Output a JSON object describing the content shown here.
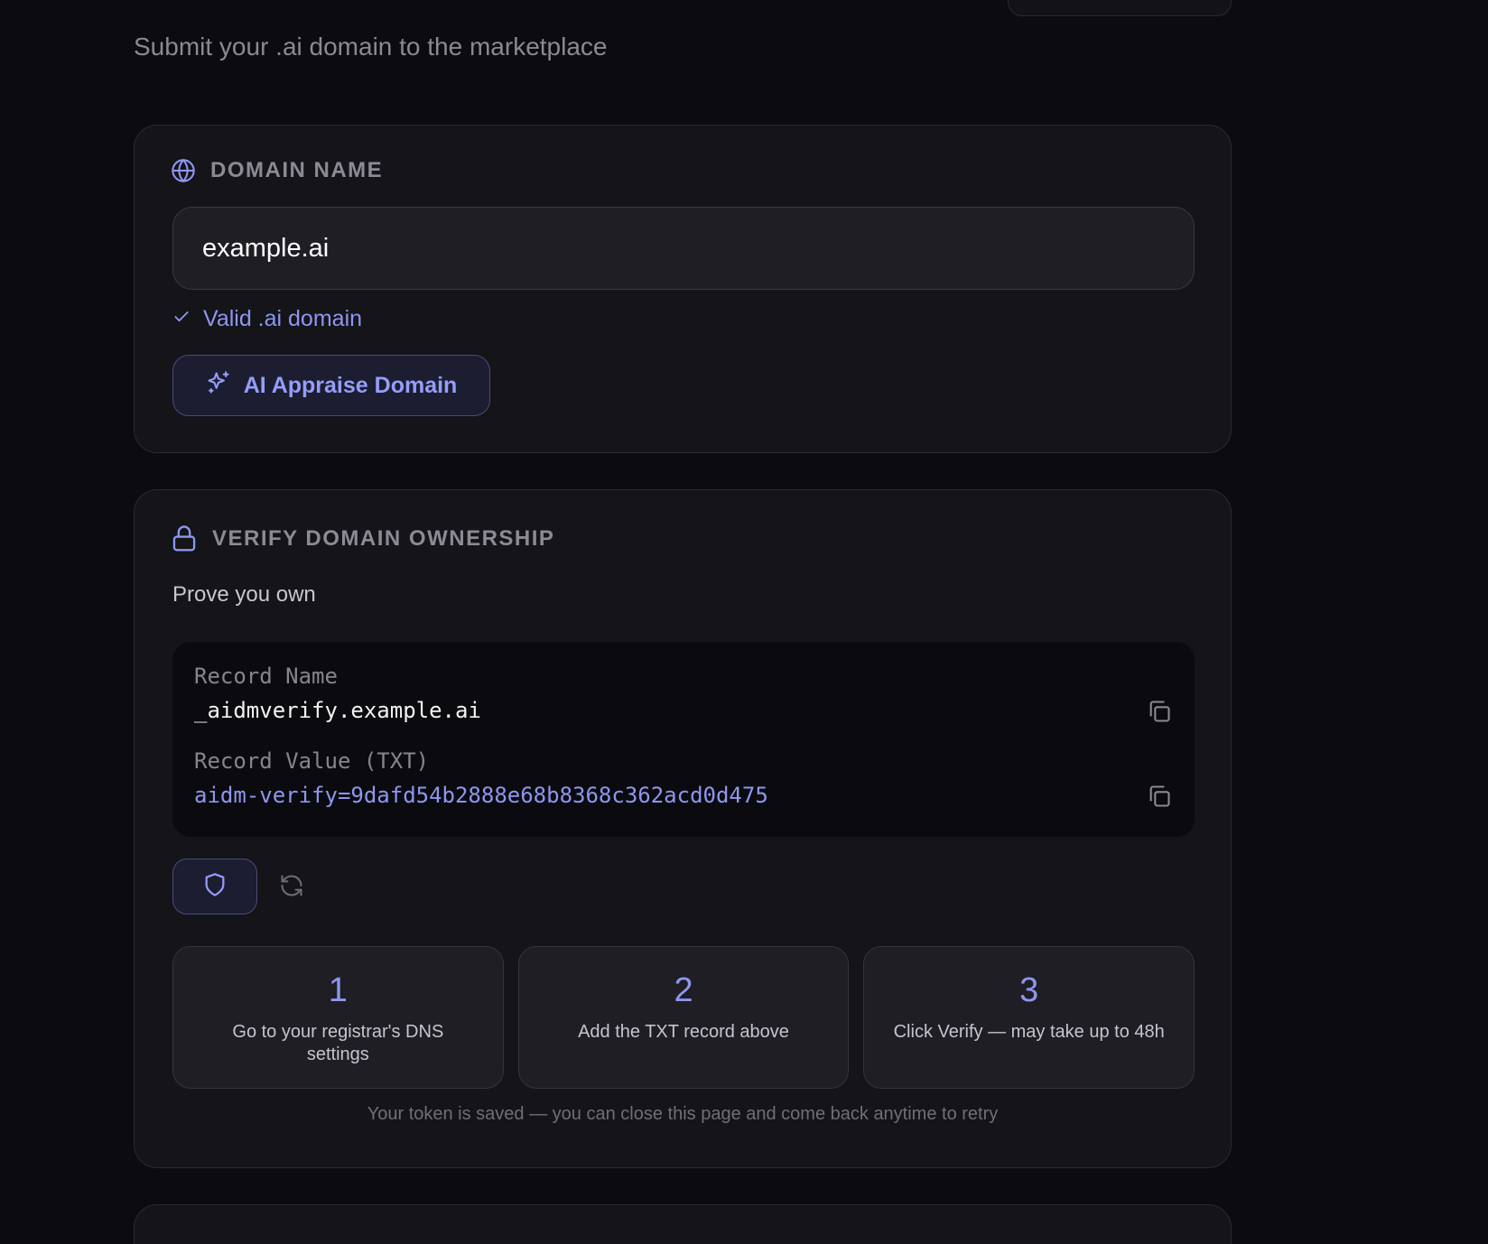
{
  "header": {
    "subtitle": "Submit your .ai domain to the marketplace"
  },
  "domain_section": {
    "heading": "DOMAIN NAME",
    "input_value": "example.ai",
    "valid_text": "Valid .ai domain",
    "appraise_label": "AI Appraise Domain"
  },
  "verify_section": {
    "heading": "VERIFY DOMAIN OWNERSHIP",
    "intro": "Prove you own",
    "record_name_label": "Record Name",
    "record_name_value": "_aidmverify.example.ai",
    "record_value_label": "Record Value (TXT)",
    "record_value": "aidm-verify=9dafd54b2888e68b8368c362acd0d475",
    "steps": [
      {
        "num": "1",
        "text": "Go to your registrar's DNS settings"
      },
      {
        "num": "2",
        "text": "Add the TXT record above"
      },
      {
        "num": "3",
        "text": "Click Verify — may take up to 48h"
      }
    ],
    "token_note": "Your token is saved — you can close this page and come back anytime to retry"
  },
  "colors": {
    "background": "#0b0b10",
    "card": "#141419",
    "accent": "#8e96f0",
    "muted": "#8a8a94"
  }
}
